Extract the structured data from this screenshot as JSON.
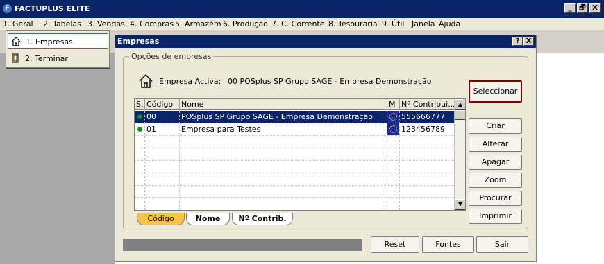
{
  "app": {
    "title": "FACTUPLUS ELITE",
    "icon_letter": "F",
    "controls": {
      "minimize": "_",
      "maximize": "🗗",
      "close": "X"
    }
  },
  "menubar": [
    "1. Geral",
    "2. Tabelas",
    "3. Vendas",
    "4. Compras",
    "5. Armazém",
    "6. Produção",
    "7. C. Corrente",
    "8. Tesouraria",
    "9. Útil",
    "Janela",
    "Ajuda"
  ],
  "dropdown": {
    "items": [
      {
        "label": "1. Empresas",
        "icon": "home-icon",
        "selected": true
      },
      {
        "label": "2. Terminar",
        "icon": "exit-door-icon",
        "selected": false
      }
    ]
  },
  "dialog": {
    "title": "Empresas",
    "help": "?",
    "close": "X",
    "group_title": "Opções de empresas",
    "active_label": "Empresa Activa:",
    "active_value": "00 POSplus SP Grupo SAGE - Empresa Demonstração",
    "buttons": {
      "seleccionar": "Seleccionar",
      "criar": "Criar",
      "alterar": "Alterar",
      "apagar": "Apagar",
      "zoom": "Zoom",
      "procurar": "Procurar",
      "imprimir": "Imprimir",
      "reset": "Reset",
      "fontes": "Fontes",
      "sair": "Sair"
    },
    "grid": {
      "columns": [
        "S.",
        "Código",
        "Nome",
        "M",
        "Nº Contribui..."
      ],
      "rows": [
        {
          "codigo": "00",
          "nome": "POSplus SP Grupo SAGE - Empresa Demonstração",
          "contrib": "555666777",
          "selected": true
        },
        {
          "codigo": "01",
          "nome": "Empresa para Testes",
          "contrib": "123456789",
          "selected": false
        }
      ]
    },
    "tabs": [
      "Código",
      "Nome",
      "Nº Contrib."
    ],
    "colors": {
      "status_green": "#1a8a1a",
      "selection": "#0a246a",
      "tab_active": "#f7c443",
      "seleccionar_border": "#800000"
    }
  }
}
